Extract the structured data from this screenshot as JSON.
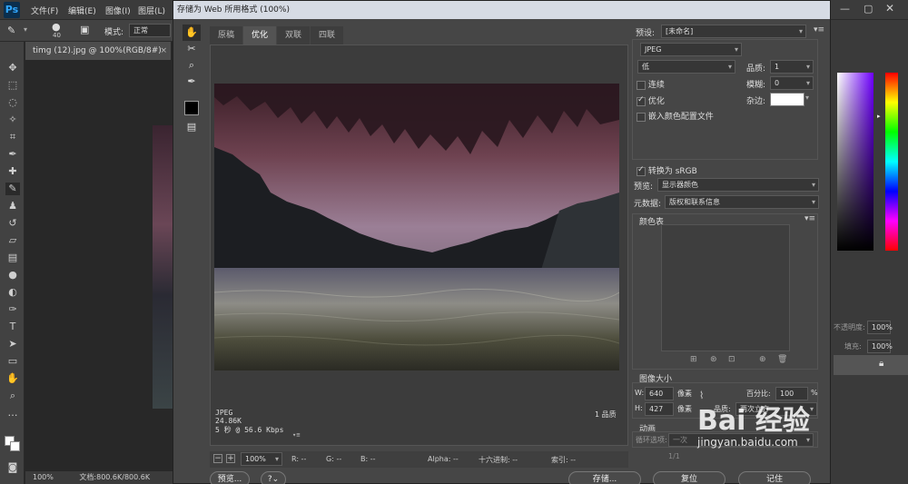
{
  "app": {
    "logo": "Ps",
    "menus": [
      "文件(F)",
      "编辑(E)",
      "图像(I)",
      "图层(L)"
    ],
    "options": {
      "brush_size": "40",
      "mode_label": "模式:",
      "mode_value": "正常"
    },
    "document_tab": "timg (12).jpg @ 100%(RGB/8#)",
    "status": {
      "zoom": "100%",
      "doc": "文档:800.6K/800.6K"
    }
  },
  "right_panel": {
    "opacity_label": "不透明度:",
    "opacity_value": "100%",
    "fill_label": "填充:",
    "fill_value": "100%"
  },
  "dialog": {
    "title": "存储为 Web 所用格式 (100%)",
    "view_tabs": [
      "原稿",
      "优化",
      "双联",
      "四联"
    ],
    "active_tab": "优化",
    "preview_info": {
      "format": "JPEG",
      "size": "24.86K",
      "speed": "5 秒 @ 56.6 Kbps",
      "quality_label": "1 品质"
    },
    "zoom_bar": {
      "zoom_value": "100%",
      "r": "R: --",
      "g": "G: --",
      "b": "B: --",
      "alpha": "Alpha: --",
      "hex": "十六进制: --",
      "index": "索引: --"
    },
    "buttons": {
      "preview": "预览...",
      "save": "存储...",
      "reset": "复位",
      "remember": "记住"
    },
    "settings": {
      "preset_label": "预设:",
      "preset_value": "[未命名]",
      "format_value": "JPEG",
      "quality_level": "低",
      "quality_label": "品质:",
      "quality_value": "1",
      "blur_label": "模糊:",
      "blur_value": "0",
      "matte_label": "杂边:",
      "progressive_label": "连续",
      "optimized_label": "优化",
      "embed_profile_label": "嵌入颜色配置文件",
      "convert_srgb_label": "转换为 sRGB",
      "preview_label": "预览:",
      "preview_value": "显示器颜色",
      "metadata_label": "元数据:",
      "metadata_value": "版权和联系信息",
      "color_table_label": "颜色表"
    },
    "image_size": {
      "title": "图像大小",
      "w_label": "W:",
      "w_value": "640",
      "h_label": "H:",
      "h_value": "427",
      "unit": "像素",
      "percent_label": "百分比:",
      "percent_value": "100",
      "percent_unit": "%",
      "quality_label": "品质:",
      "quality_value": "两次立方"
    },
    "animation": {
      "title": "动画",
      "loop_label": "循环选项:",
      "loop_value": "一次",
      "frame": "1/1"
    }
  },
  "watermark": {
    "text": "Bai 经验",
    "url": "jingyan.baidu.com"
  }
}
